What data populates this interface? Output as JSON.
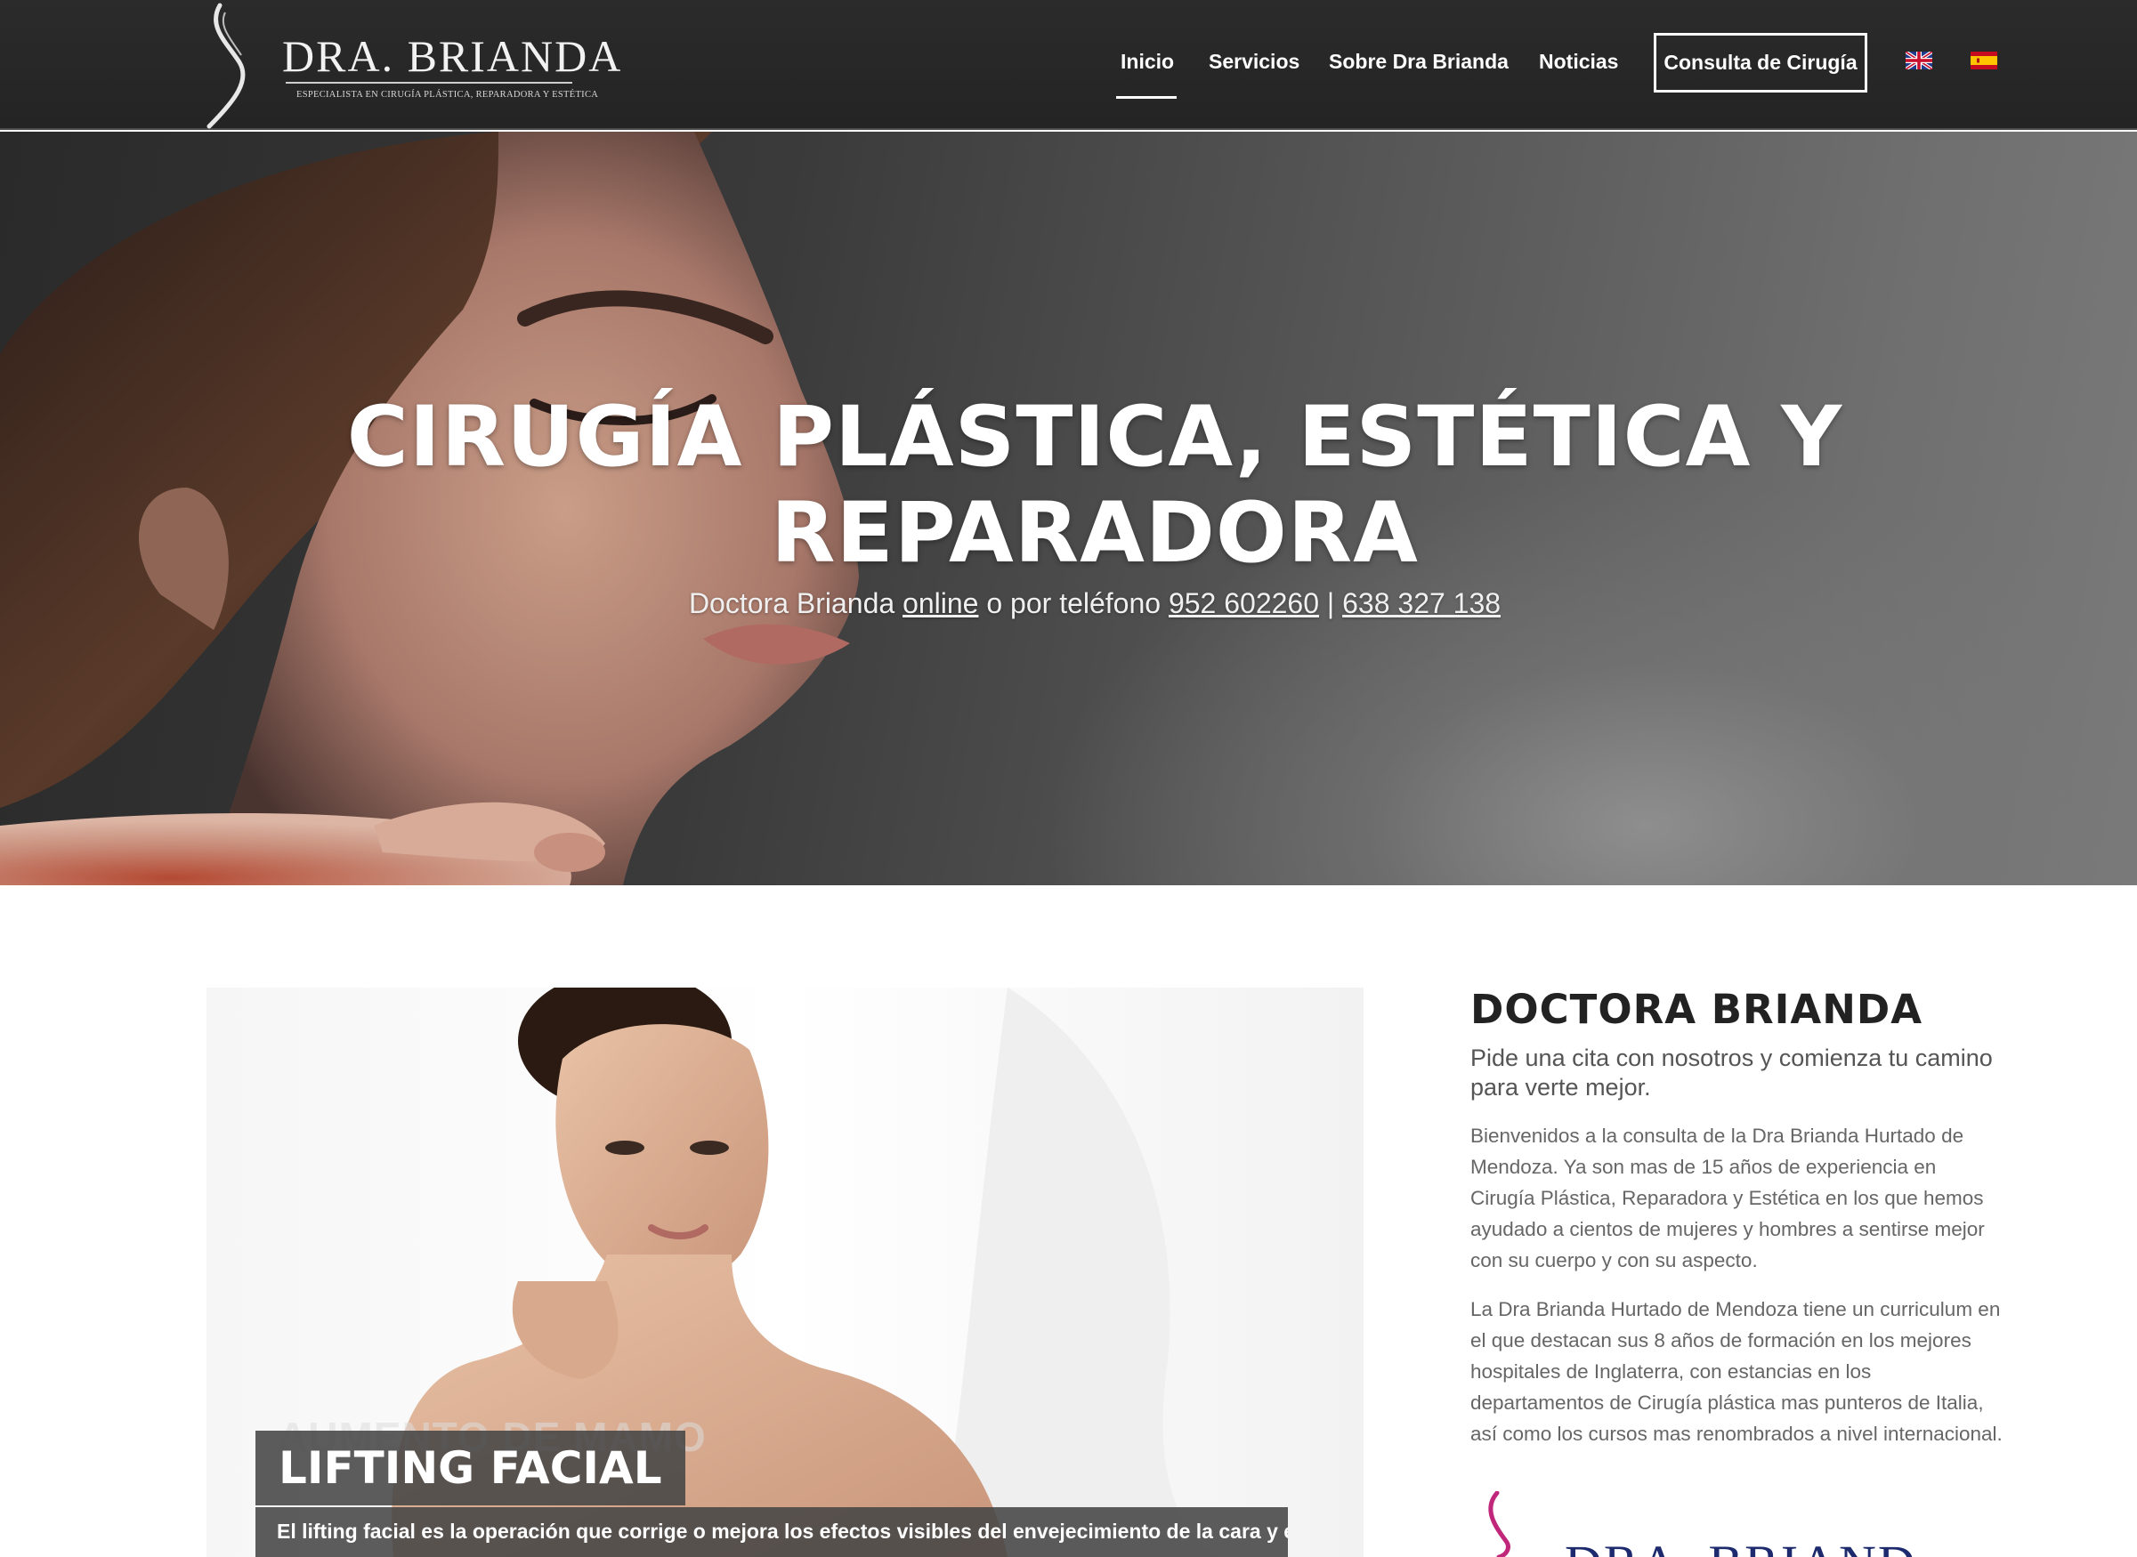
{
  "header": {
    "logo_title": "DRA. BRIANDA",
    "logo_tagline": "ESPECIALISTA EN CIRUGÍA PLÁSTICA, REPARADORA Y ESTÉTICA",
    "nav": [
      {
        "label": "Inicio",
        "active": true
      },
      {
        "label": "Servicios"
      },
      {
        "label": "Sobre Dra Brianda"
      },
      {
        "label": "Noticias"
      }
    ],
    "cta_label": "Consulta de Cirugía",
    "languages": [
      "english-flag-icon",
      "spanish-flag-icon"
    ]
  },
  "hero": {
    "title_line1": "CIRUGÍA PLÁSTICA, ESTÉTICA Y",
    "title_line2": "REPARADORA",
    "sub_prefix": "Doctora Brianda ",
    "sub_link_online": "online",
    "sub_middle": " o por teléfono ",
    "phone_1": "952 602260",
    "separator": " | ",
    "phone_2": "638 327 138"
  },
  "feature": {
    "ghost_title": "AUMENTO DE MAMO",
    "slide_title": "LIFTING FACIAL",
    "slide_caption": "El lifting facial es la operación que corrige o mejora los efectos visibles del envejecimiento de la cara y el cuello"
  },
  "intro": {
    "heading_light": "DOCTORA ",
    "heading_bold": "BRIANDA",
    "lead": "Pide una cita con nosotros y comienza tu camino para verte mejor.",
    "paragraph_1": "Bienvenidos a la consulta de la Dra Brianda Hurtado de Mendoza. Ya son mas de 15 años de experiencia en Cirugía Plástica, Reparadora y Estética en los que hemos ayudado a cientos de mujeres y hombres a sentirse mejor con su cuerpo y con su aspecto.",
    "paragraph_2": "La Dra Brianda Hurtado de Mendoza tiene un curriculum en el que destacan sus 8 años de formación en los mejores hospitales de Inglaterra, con estancias en los departamentos de Cirugía plástica mas punteros de Italia, así como los cursos mas renombrados a nivel internacional.",
    "logo_title": "DRA. BRIANDA"
  },
  "colors": {
    "header_bg": "#262626",
    "brand_navy": "#1d2a6e",
    "brand_magenta": "#c0267a",
    "caption_bg": "#464646"
  }
}
